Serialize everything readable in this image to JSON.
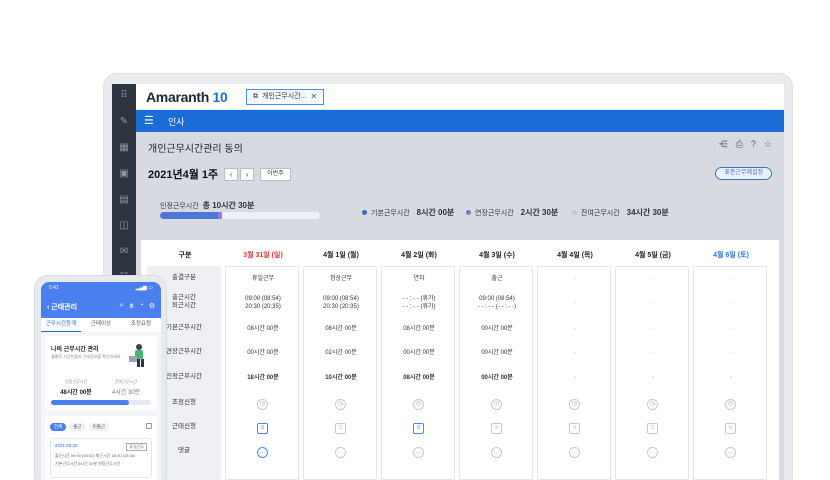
{
  "app": {
    "brand": "Amaranth",
    "brand_num": "10",
    "tab_label": "개인근무시간...",
    "nav_title": "인사"
  },
  "page": {
    "title": "개인근무시간관리 동의",
    "week_label": "2021년4월 1주",
    "this_week": "이번주",
    "status_button": "표준근무제설정"
  },
  "summary": {
    "label": "인정근무시간",
    "total": "총 10시간 30분",
    "legend": [
      {
        "name": "기본근무시간",
        "value": "8시간 00분",
        "color": "#3b67d1"
      },
      {
        "name": "연장근무시간",
        "value": "2시간 30분",
        "color": "#8a6fd8"
      },
      {
        "name": "잔여근무시간",
        "value": "34시간 30분",
        "color": "#c4c9d0"
      }
    ],
    "progress": {
      "basic_fraction": 0.36,
      "overtime_fraction": 0.03
    }
  },
  "table": {
    "header": "구분",
    "days": [
      {
        "label": "3월 31일 (일)",
        "color": "#e23b3b"
      },
      {
        "label": "4월 1일 (월)",
        "color": "#222222"
      },
      {
        "label": "4월 2일 (화)",
        "color": "#222222"
      },
      {
        "label": "4월 3일 (수)",
        "color": "#222222"
      },
      {
        "label": "4월 4일 (목)",
        "color": "#222222"
      },
      {
        "label": "4월 5일 (금)",
        "color": "#222222"
      },
      {
        "label": "4월 6일 (토)",
        "color": "#2d76e0"
      }
    ],
    "rows": [
      "출결구분",
      "출근시간\n퇴근시간",
      "기본근무시간",
      "연장근무시간",
      "인정근무시간",
      "조정신청",
      "근태신청",
      "댓글"
    ],
    "values": [
      [
        "휴일근무",
        "09:00 (08:54)\n20:30 (20:35)",
        "08시간 00분",
        "00시간 00분",
        "18시간 00분"
      ],
      [
        "정상근무",
        "09:00 (08:54)\n20:30 (20:35)",
        "08시간 00분",
        "02시간 00분",
        "10시간 00분"
      ],
      [
        "연차",
        "- - : - - (휴가)\n- - : - - (휴가)",
        "08시간 00분",
        "00시간 00분",
        "08시간 00분"
      ],
      [
        "출근",
        "09:00 (08:54)\n- - : - - (- - : - -)",
        "00시간 00분",
        "00시간 00분",
        "00시간 00분"
      ],
      [
        "-",
        "-",
        "-",
        "-",
        "-"
      ],
      [
        "-",
        "-",
        "-",
        "-",
        "-"
      ],
      [
        "-",
        "-",
        "-",
        "-",
        "-"
      ]
    ],
    "active_doc_days": [
      0,
      2
    ],
    "active_comment_days": [
      0
    ]
  },
  "mobile": {
    "time": "5:41",
    "title": "근태관리",
    "tabs": [
      "근무시간등계",
      "근태이상",
      "조정요청"
    ],
    "card_title": "나의 근무시간 관리",
    "card_sub": "월별로 시간현황과 근태정보를 확인하세요.",
    "stat1_label": "인정근무시간",
    "stat1_value": "48시간 00분",
    "stat2_label": "잔여근무시간",
    "stat2_value": "4시간 30분",
    "chips": [
      "전체",
      "출근",
      "미출근"
    ],
    "item_date": "2021.03.25",
    "item_badge": "휴일근무",
    "item_row1": "출근시간    09:00 (08:52)    퇴근시간    18:00 (18:30)",
    "item_row2": "기본근무시간    8시간 00분    연장근무시간"
  }
}
